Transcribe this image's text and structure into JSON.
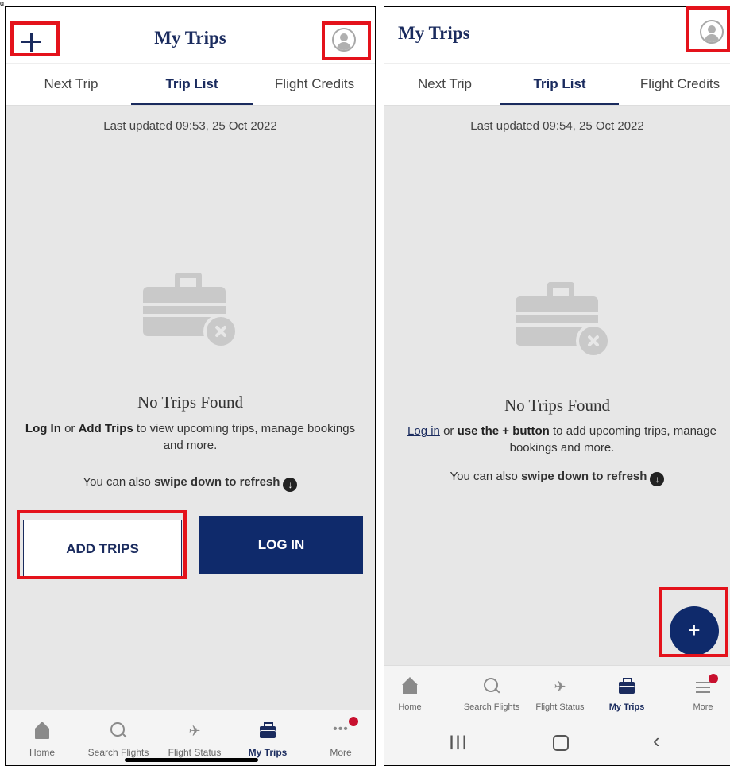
{
  "figure_label": "g",
  "left": {
    "title": "My Trips",
    "tabs": [
      "Next Trip",
      "Trip List",
      "Flight Credits"
    ],
    "last_updated": "Last updated 09:53, 25 Oct 2022",
    "empty_title": "No Trips Found",
    "message": {
      "login": "Log In",
      "or": " or ",
      "add": "Add Trips",
      "rest": " to view upcoming trips, manage bookings and more."
    },
    "swipe": {
      "prefix": "You can also ",
      "bold": "swipe down to refresh"
    },
    "buttons": {
      "add": "ADD TRIPS",
      "login": "LOG IN"
    },
    "nav": [
      "Home",
      "Search Flights",
      "Flight Status",
      "My Trips",
      "More"
    ]
  },
  "right": {
    "title": "My Trips",
    "tabs": [
      "Next Trip",
      "Trip List",
      "Flight Credits"
    ],
    "last_updated": "Last updated 09:54, 25 Oct 2022",
    "empty_title": "No Trips Found",
    "message": {
      "login": "Log in",
      "or": " or ",
      "use": "use the + button",
      "rest": " to add upcoming trips, manage bookings and more."
    },
    "swipe": {
      "prefix": "You can also ",
      "bold": "swipe down to refresh"
    },
    "fab": "+",
    "nav": [
      "Home",
      "Search Flights",
      "Flight Status",
      "My Trips",
      "More"
    ]
  },
  "colors": {
    "brand_navy": "#1a2b5e",
    "button_navy": "#0f2a6b",
    "highlight_red": "#e4121b",
    "badge_red": "#c8102e",
    "content_grey": "#e7e7e7"
  },
  "icons": [
    "plus-icon",
    "profile-icon",
    "luggage-x-icon",
    "refresh-down-icon",
    "home-icon",
    "search-icon",
    "flight-status-icon",
    "suitcase-icon",
    "more-dots-icon",
    "menu-icon"
  ]
}
